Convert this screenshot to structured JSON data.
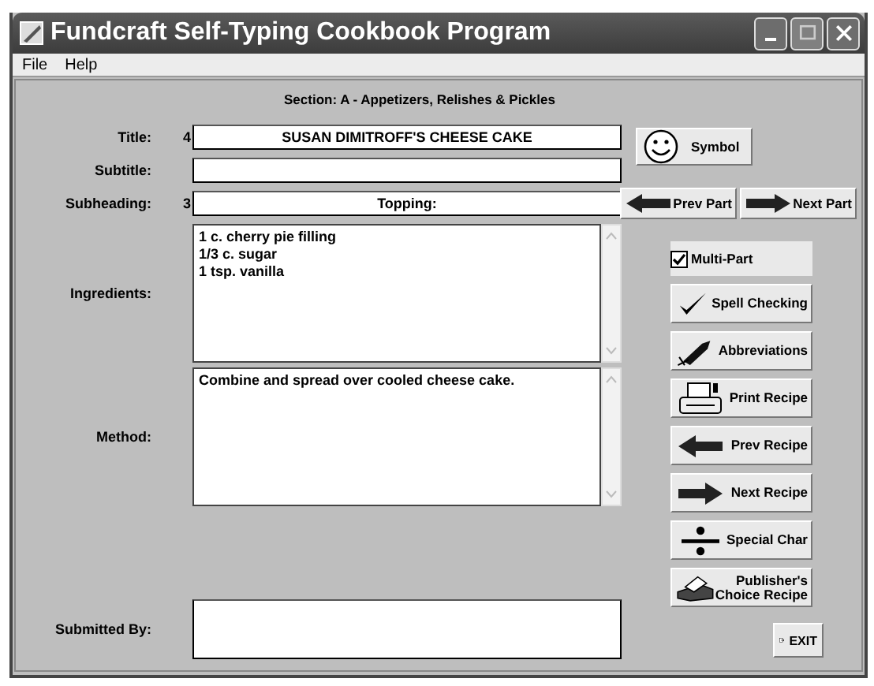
{
  "window": {
    "title": "Fundcraft Self-Typing Cookbook Program"
  },
  "menu": [
    {
      "label": "File"
    },
    {
      "label": "Help"
    }
  ],
  "section": "Section: A - Appetizers, Relishes & Pickles",
  "title": {
    "label": "Title:",
    "number": "4",
    "value": "SUSAN DIMITROFF'S CHEESE CAKE"
  },
  "subtitle": {
    "label": "Subtitle:"
  },
  "subheading": {
    "label": "Subheading:",
    "number": "3",
    "value": "Topping:"
  },
  "ingredients": {
    "label": "Ingredients:",
    "lines": [
      "1 c. cherry pie filling",
      "1/3 c. sugar",
      "1 tsp. vanilla"
    ]
  },
  "method": {
    "label": "Method:",
    "lines": [
      "Combine and spread over cooled cheese cake."
    ]
  },
  "submitted_by": {
    "label": "Submitted By:"
  },
  "symbol_button": {
    "label": "Symbol"
  },
  "part_buttons": [
    {
      "label": "Prev Part",
      "kind": "left"
    },
    {
      "label": "Next Part",
      "kind": "right"
    }
  ],
  "multi_part": {
    "label": "Multi-Part",
    "checked": true
  },
  "actions": [
    {
      "label": "Spell Checking",
      "kind": "check"
    },
    {
      "label": "Abbreviations",
      "kind": "pen"
    },
    {
      "label": "Print Recipe",
      "kind": "printer"
    },
    {
      "label": "Prev Recipe",
      "kind": "left"
    },
    {
      "label": "Next Recipe",
      "kind": "right"
    },
    {
      "label": "Special Char",
      "kind": "divide"
    },
    {
      "label": "Publisher's\nChoice Recipe",
      "kind": "fax"
    }
  ],
  "exit_button": {
    "label": "EXIT"
  }
}
